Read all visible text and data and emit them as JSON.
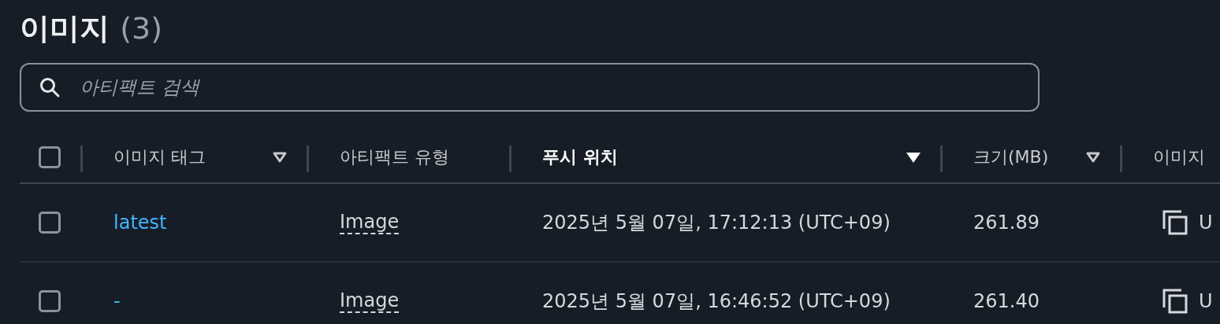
{
  "title": "이미지",
  "count": "(3)",
  "search": {
    "placeholder": "아티팩트 검색"
  },
  "table": {
    "select_all": {
      "checked": false
    },
    "columns": [
      {
        "label": "이미지 태그",
        "sortable": true,
        "sorted": false
      },
      {
        "label": "아티팩트 유형",
        "sortable": false,
        "sorted": false
      },
      {
        "label": "푸시 위치",
        "sortable": true,
        "sorted": true
      },
      {
        "label": "크기(MB)",
        "sortable": true,
        "sorted": false
      },
      {
        "label": "이미지",
        "sortable": false,
        "sorted": false
      }
    ],
    "rows": [
      {
        "checked": false,
        "tag": "latest",
        "type": "Image",
        "pushed": "2025년 5월 07일, 17:12:13 (UTC+09)",
        "size": "261.89",
        "uri": "U"
      },
      {
        "checked": false,
        "tag": "-",
        "type": "Image",
        "pushed": "2025년 5월 07일, 16:46:52 (UTC+09)",
        "size": "261.40",
        "uri": "U"
      }
    ]
  }
}
